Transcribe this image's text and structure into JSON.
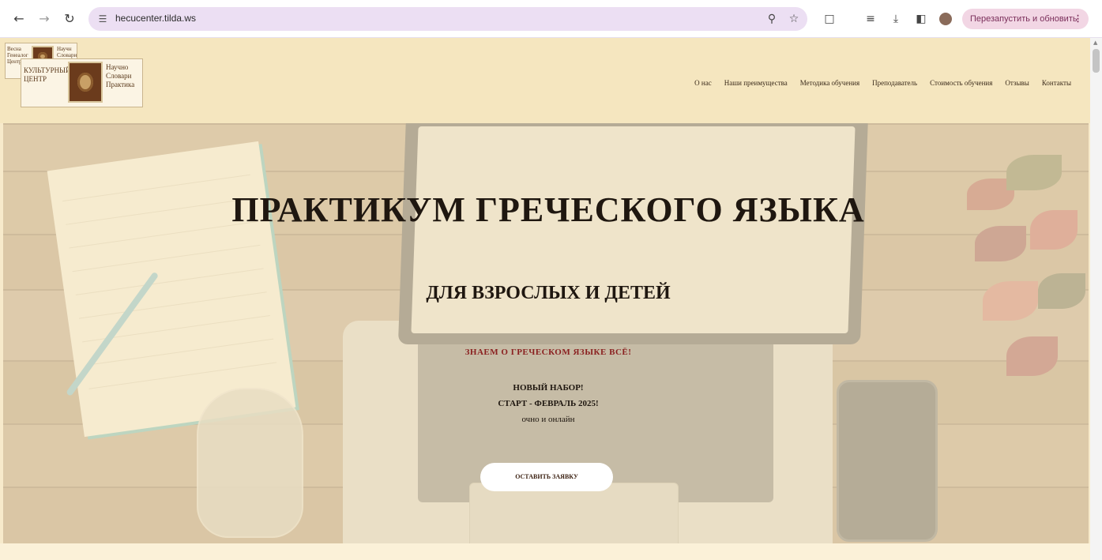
{
  "browser": {
    "url": "hecucenter.tilda.ws",
    "relaunch_label": "Перезапустить и обновить"
  },
  "site": {
    "menu": [
      "О нас",
      "Наши преимущества",
      "Методика обучения",
      "Преподаватель",
      "Стоимость обучения",
      "Отзывы",
      "Контакты"
    ]
  },
  "hero": {
    "title": "ПРАКТИКУМ ГРЕЧЕСКОГО ЯЗЫКА",
    "subtitle": "ДЛЯ ВЗРОСЛЫХ И ДЕТЕЙ",
    "tagline": "ЗНАЕМ О ГРЕЧЕСКОМ ЯЗЫКЕ ВСЁ!",
    "line1": "НОВЫЙ НАБОР!",
    "line2": "СТАРТ - ФЕВРАЛЬ 2025!",
    "line3": "очно и онлайн",
    "cta": "ОСТАВИТЬ ЗАЯВКУ"
  }
}
